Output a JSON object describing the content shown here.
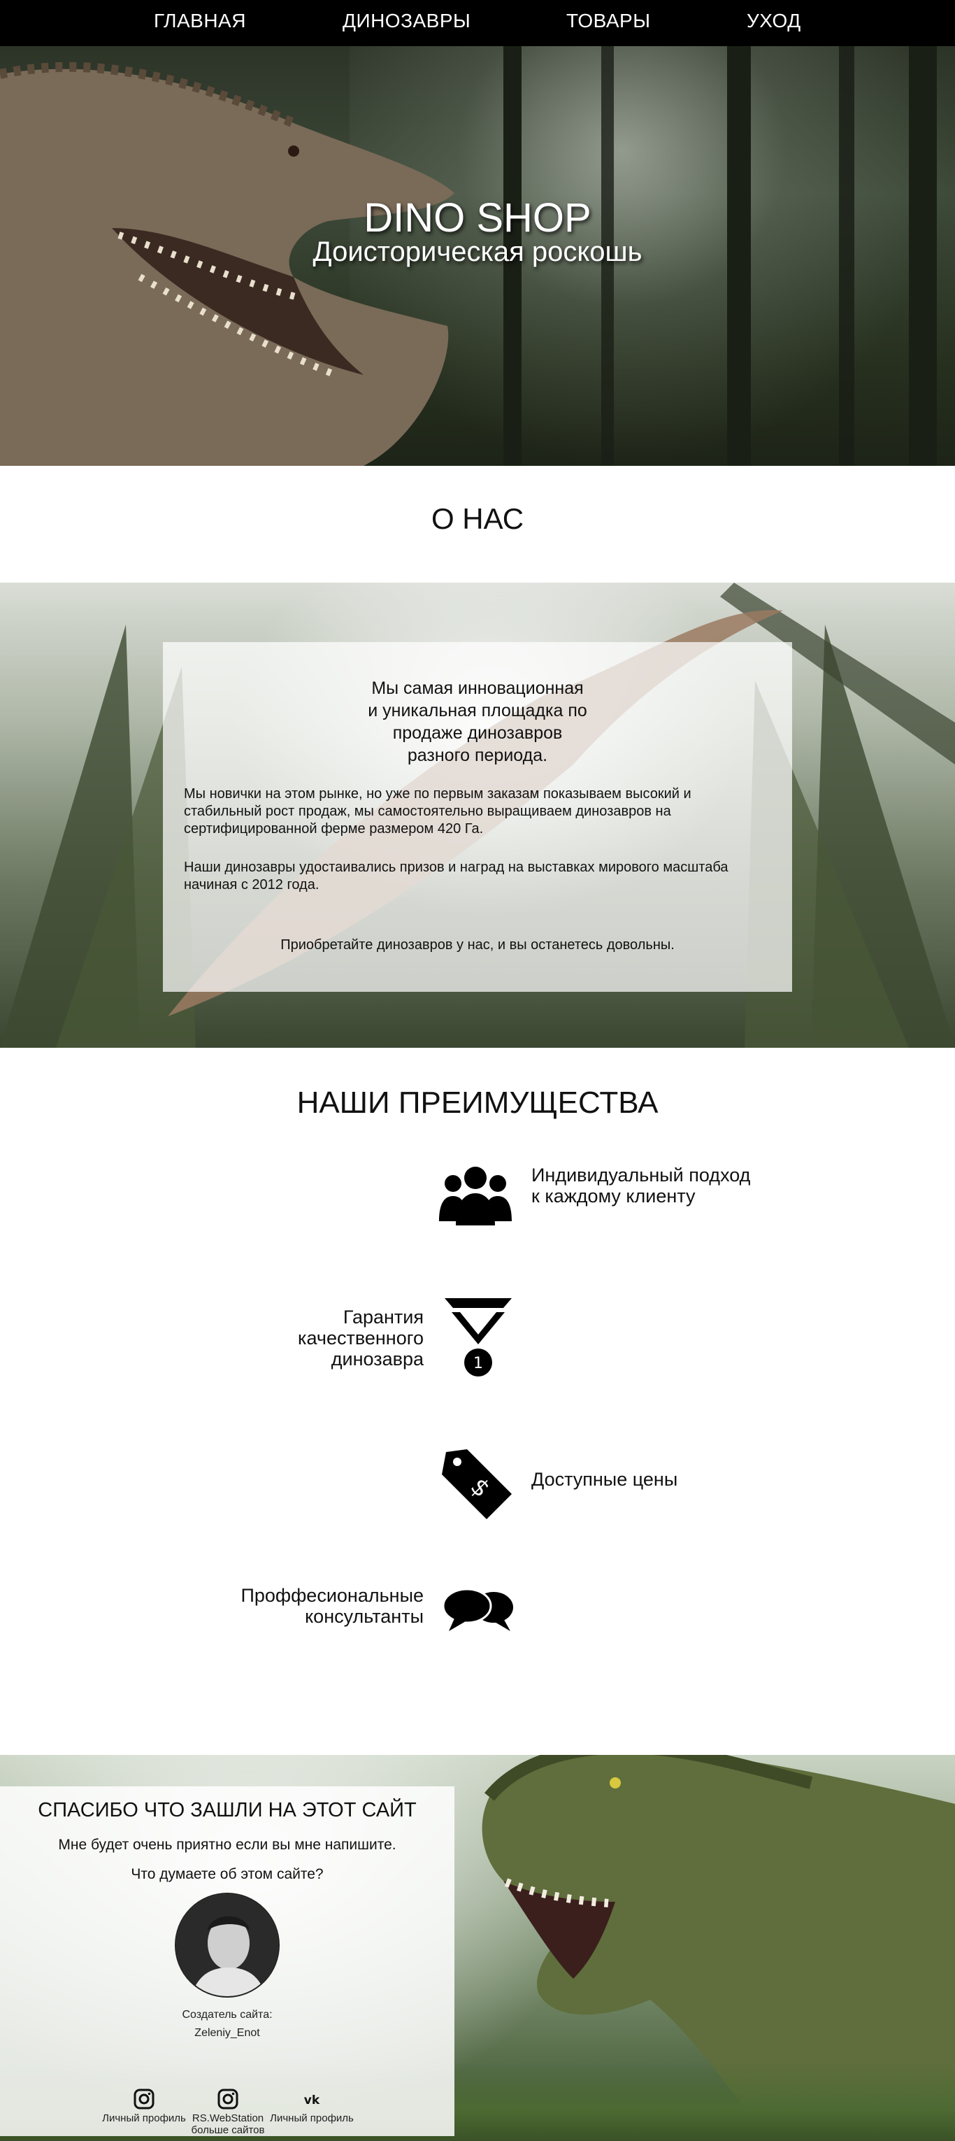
{
  "nav": {
    "items": [
      "ГЛАВНАЯ",
      "ДИНОЗАВРЫ",
      "ТОВАРЫ",
      "УХОД"
    ]
  },
  "hero": {
    "title": "DINO SHOP",
    "subtitle": "Доисторическая роскошь"
  },
  "about": {
    "title": "О НАС",
    "lead": "Мы самая инновационная и уникальная площадка по продаже динозавров разного периода.",
    "paragraph1": "Мы новички на этом рынке, но уже по первым заказам показываем высокий и стабильный рост продаж, мы самостоятельно выращиваем динозавров на сертифицированной ферме размером 420 Га.",
    "paragraph2": "Наши динозавры удостаивались призов и наград на выставках мирового масштаба начиная с 2012 года.",
    "footer": "Приобретайте динозавров у нас, и вы останетесь довольны."
  },
  "advantages": {
    "title": "НАШИ ПРЕИМУЩЕСТВА",
    "items": [
      {
        "text": "Индивидуальный подход к каждому клиенту",
        "icon": "users-icon"
      },
      {
        "text": "Гарантия качественного динозавра",
        "icon": "medal-icon"
      },
      {
        "text": "Доступные цены",
        "icon": "price-tag-icon"
      },
      {
        "text": "Проффесиональные консультанты",
        "icon": "chat-bubbles-icon"
      }
    ]
  },
  "footer": {
    "title": "СПАСИБО ЧТО ЗАШЛИ НА ЭТОТ САЙТ",
    "line1": "Мне будет очень приятно если вы мне напишите.",
    "line2": "Что думаете об этом сайте?",
    "creator_label": "Создатель сайта:",
    "creator_name": "Zeleniy_Enot",
    "social": [
      {
        "label": "Личный профиль",
        "icon": "instagram-icon"
      },
      {
        "label": "RS.WebStation больше сайтов",
        "icon": "instagram-icon"
      },
      {
        "label": "Личный профиль",
        "icon": "vk-icon"
      }
    ]
  }
}
